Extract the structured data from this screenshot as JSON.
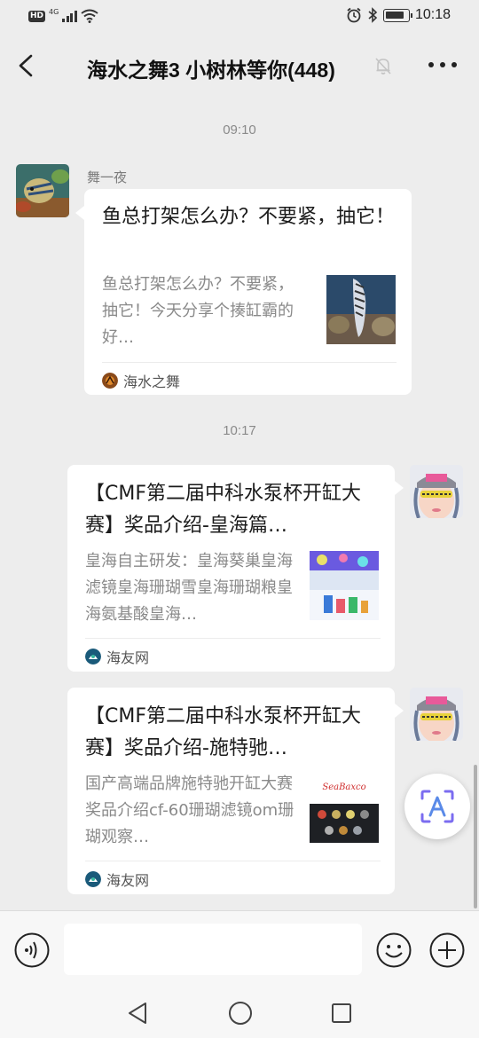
{
  "status_bar": {
    "hd": "HD",
    "signal": "4G",
    "time": "10:18"
  },
  "header": {
    "title": "海水之舞3 小树林等你(448)"
  },
  "messages": [
    {
      "time": "09:10",
      "sender": "舞一夜",
      "card": {
        "title": "鱼总打架怎么办？不要紧，抽它！",
        "desc": "鱼总打架怎么办？不要紧，抽它！今天分享个揍缸霸的好…",
        "source": "海水之舞"
      }
    },
    {
      "time": "10:17",
      "card": {
        "title": "【CMF第二届中科水泵杯开缸大赛】奖品介绍-皇海篇…",
        "desc": "皇海自主研发：皇海葵巢皇海滤镜皇海珊瑚雪皇海珊瑚粮皇海氨基酸皇海…",
        "source": "海友网"
      }
    },
    {
      "card": {
        "title": "【CMF第二届中科水泵杯开缸大赛】奖品介绍-施特驰…",
        "desc": "国产高端品牌施特驰开缸大赛奖品介绍cf-60珊瑚滤镜om珊瑚观察…",
        "source": "海友网",
        "thumb_brand": "SeaBaxco"
      }
    }
  ],
  "icons": {
    "back": "chevron-left-icon",
    "mute": "bell-muted-icon",
    "more": "more-dots-icon",
    "voice": "voice-icon",
    "emoji": "emoji-icon",
    "plus": "plus-icon",
    "float": "text-recognition-icon"
  },
  "colors": {
    "background": "#ededed",
    "card": "#ffffff",
    "muted_text": "#8a8a8a",
    "float_icon": "#7b6cf0"
  }
}
